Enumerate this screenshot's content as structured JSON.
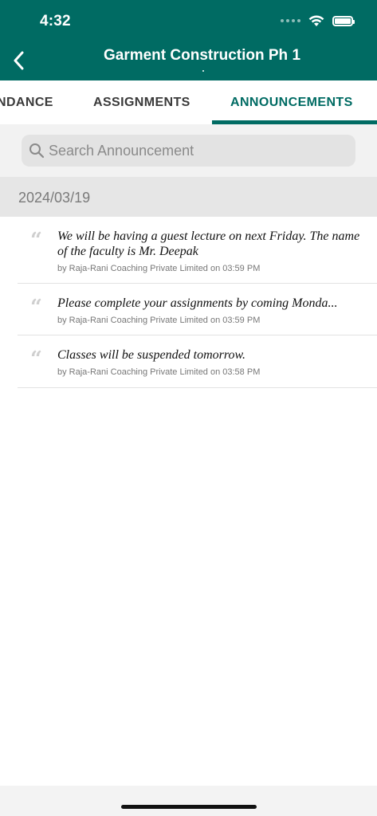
{
  "status_bar": {
    "time": "4:32"
  },
  "header": {
    "title": "Garment Construction Ph 1"
  },
  "tabs": [
    {
      "label": "NDANCE"
    },
    {
      "label": "ASSIGNMENTS"
    },
    {
      "label": "ANNOUNCEMENTS",
      "selected": true
    }
  ],
  "search": {
    "placeholder": "Search Announcement"
  },
  "section": {
    "date": "2024/03/19"
  },
  "announcements": [
    {
      "text": "We will be having a guest lecture on next Friday. The name of the faculty is Mr. Deepak",
      "meta": "by Raja-Rani Coaching Private Limited on 03:59 PM"
    },
    {
      "text": "Please complete your assignments by coming Monda...",
      "meta": "by Raja-Rani Coaching Private Limited on 03:59 PM"
    },
    {
      "text": "Classes will be suspended tomorrow.",
      "meta": "by Raja-Rani Coaching Private Limited on 03:58 PM"
    }
  ],
  "icons": {
    "back": "chevron-left-icon",
    "search": "search-icon",
    "quote": "quote-icon",
    "wifi": "wifi-icon",
    "battery": "battery-icon"
  },
  "colors": {
    "primary": "#006b63",
    "date_band": "#e6e6e6",
    "search_band": "#f2f2f2"
  }
}
